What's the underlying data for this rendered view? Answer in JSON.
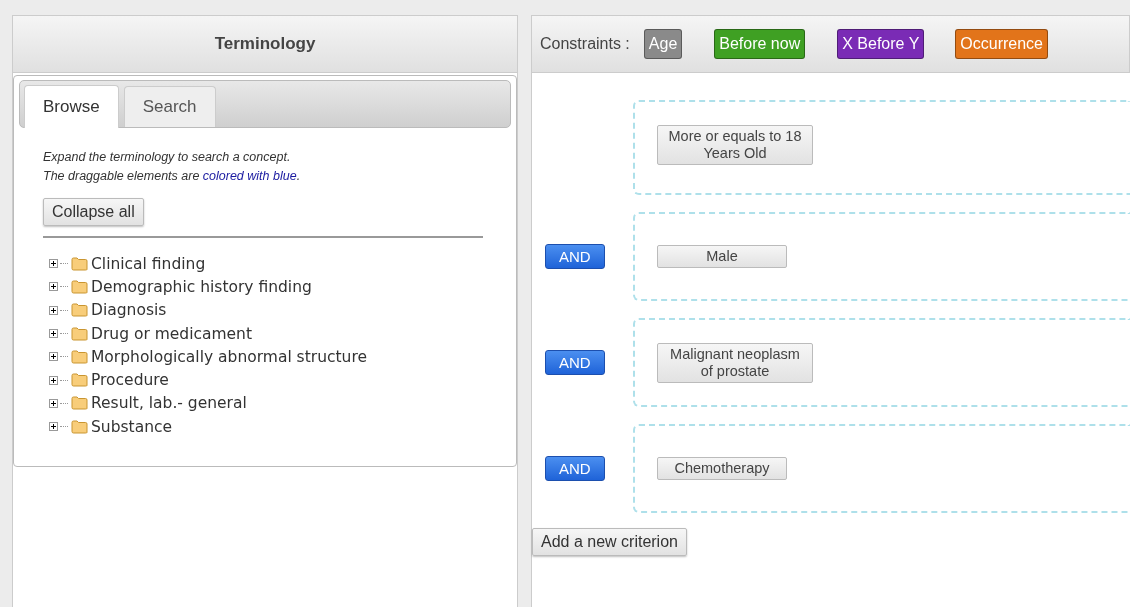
{
  "terminology": {
    "title": "Terminology",
    "tabs": [
      {
        "label": "Browse",
        "selected": true
      },
      {
        "label": "Search",
        "selected": false
      }
    ],
    "hints": [
      {
        "parts": [
          {
            "text": "Expand the terminology to search a concept.",
            "kind": "plain"
          }
        ]
      },
      {
        "parts": [
          {
            "text": "The draggable elements are ",
            "kind": "plain"
          },
          {
            "text": "colored with blue",
            "kind": "accent"
          },
          {
            "text": ".",
            "kind": "plain"
          }
        ]
      }
    ],
    "collapse_button": "Collapse all",
    "tree": [
      {
        "label": "Clinical finding",
        "expanded": false
      },
      {
        "label": "Demographic history finding",
        "expanded": false
      },
      {
        "label": "Diagnosis",
        "expanded": false
      },
      {
        "label": "Drug or medicament",
        "expanded": false
      },
      {
        "label": "Morphologically abnormal structure",
        "expanded": false
      },
      {
        "label": "Procedure",
        "expanded": false
      },
      {
        "label": "Result, lab.- general",
        "expanded": false
      },
      {
        "label": "Substance",
        "expanded": false
      }
    ]
  },
  "constraints": {
    "label": "Constraints :",
    "items": [
      {
        "label": "Age",
        "color": "#8a8a8a"
      },
      {
        "label": "Before now",
        "color": "#3fa023"
      },
      {
        "label": "X Before Y",
        "color": "#7a2bb5"
      },
      {
        "label": "Occurrence",
        "color": "#e2741a"
      }
    ]
  },
  "criteria": [
    {
      "label": "More or equals to 18 Years Old"
    },
    {
      "connector": "AND",
      "label": "Male"
    },
    {
      "connector": "AND",
      "label": "Malignant neoplasm of prostate"
    },
    {
      "connector": "AND",
      "label": "Chemotherapy"
    }
  ],
  "add_button": "Add a new criterion"
}
